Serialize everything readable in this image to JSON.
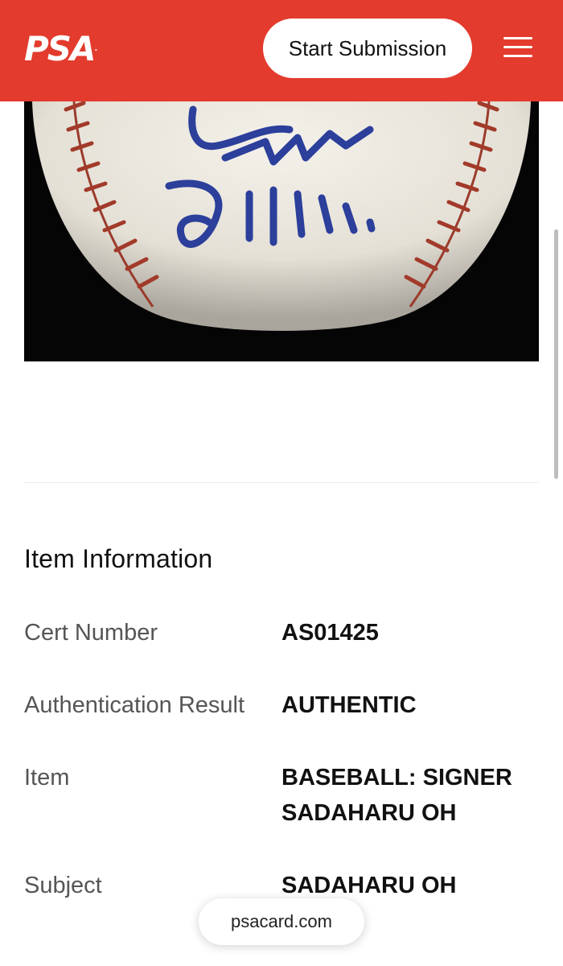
{
  "header": {
    "logo_text": "PSA",
    "logo_tm": ".",
    "start_submission_label": "Start Submission",
    "menu_icon": "hamburger-menu-icon",
    "brand_color": "#e33b2d"
  },
  "item_information": {
    "title": "Item Information",
    "rows": [
      {
        "label": "Cert Number",
        "value": "AS01425"
      },
      {
        "label": "Authentication Result",
        "value": "AUTHENTIC"
      },
      {
        "label": "Item",
        "value": "BASEBALL: SIGNER SADAHARU OH"
      },
      {
        "label": "Subject",
        "value": "SADAHARU OH"
      }
    ]
  },
  "browser": {
    "url": "psacard.com"
  }
}
